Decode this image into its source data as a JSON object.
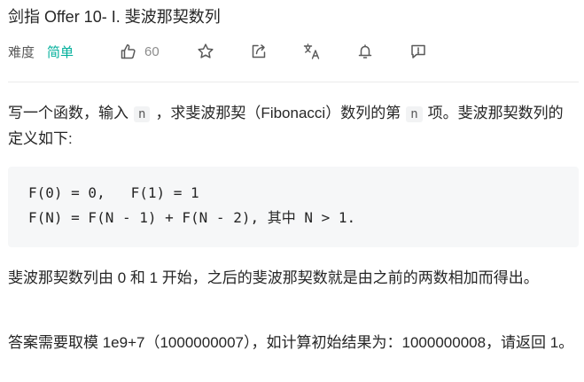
{
  "problem": {
    "title": "剑指 Offer 10- I. 斐波那契数列",
    "difficulty_label": "难度",
    "difficulty": "简单",
    "likes": "60"
  },
  "toolbar": {
    "icons": [
      "thumbs-up-icon",
      "star-icon",
      "share-icon",
      "translate-icon",
      "bell-icon",
      "feedback-icon"
    ]
  },
  "description": {
    "p1_a": "写一个函数，输入",
    "p1_code1": "n",
    "p1_b": "，求斐波那契（Fibonacci）数列的第",
    "p1_code2": "n",
    "p1_c": "项。斐波那契数列的定义如下:",
    "code_line1": "F(0) = 0,   F(1) = 1",
    "code_line2": "F(N) = F(N - 1) + F(N - 2), 其中 N > 1.",
    "p2": "斐波那契数列由 0 和 1 开始，之后的斐波那契数就是由之前的两数相加而得出。",
    "p3": "答案需要取模 1e9+7（1000000007），如计算初始结果为：1000000008，请返回 1。"
  }
}
